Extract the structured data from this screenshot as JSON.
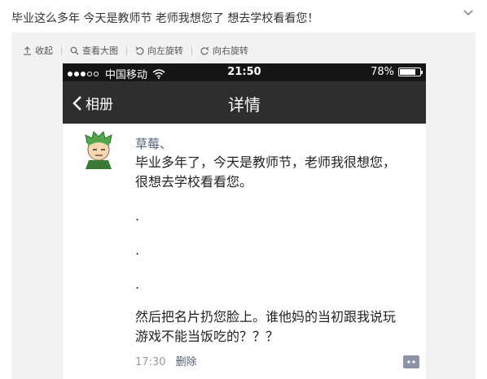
{
  "post": {
    "text": "毕业这么多年 今天是教师节 老师我想您了 想去学校看看您！"
  },
  "toolbar": {
    "collapse": "收起",
    "view_large": "查看大图",
    "rotate_left": "向左旋转",
    "rotate_right": "向右旋转"
  },
  "phone": {
    "status": {
      "carrier": "中国移动",
      "time": "21:50",
      "battery": "78%",
      "battery_level": 0.78
    },
    "nav": {
      "back_label": "相册",
      "title": "详情"
    },
    "moment": {
      "username": "草莓、",
      "lines": [
        "毕业多年了，今天是教师节，老师我很想您，",
        "很想去学校看看您。",
        ".",
        ".",
        ".",
        "然后把名片扔您脸上。谁他妈的当初跟我说玩",
        "游戏不能当饭吃的？？？"
      ],
      "time": "17:30",
      "delete_label": "删除"
    }
  },
  "colors": {
    "statusbar": "#151515",
    "navbar": "#2e2e2e",
    "link": "#50607a",
    "media_bg": "#f2f2f5"
  }
}
